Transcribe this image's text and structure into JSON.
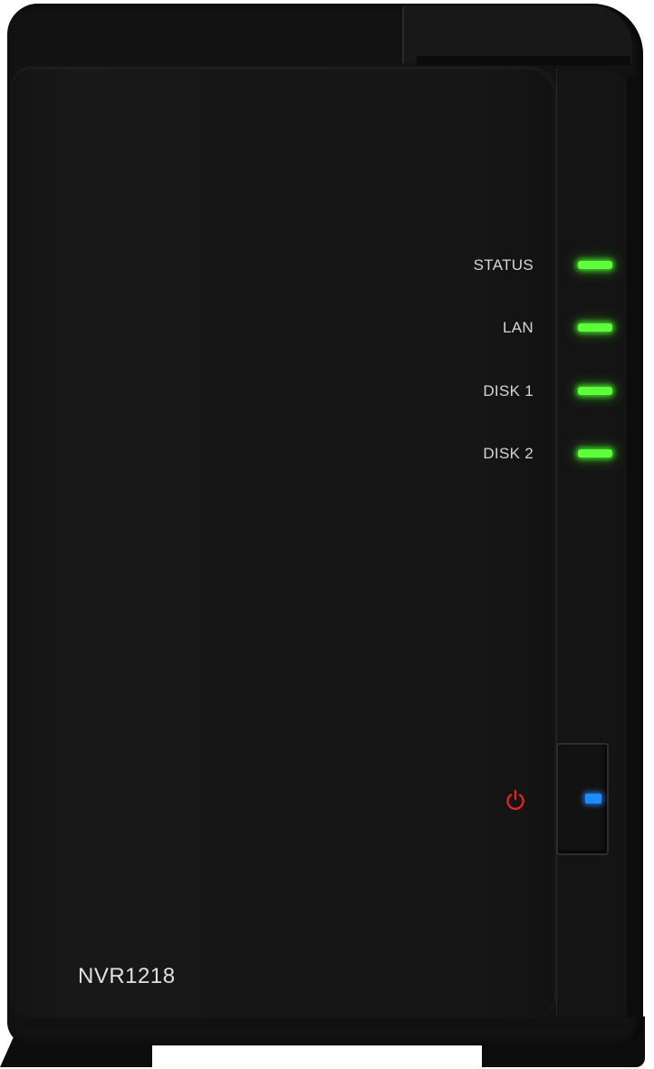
{
  "device": {
    "model": "NVR1218",
    "indicators": [
      {
        "label": "STATUS",
        "state_color": "#5cff3a"
      },
      {
        "label": "LAN",
        "state_color": "#5cff3a"
      },
      {
        "label": "DISK 1",
        "state_color": "#5cff3a"
      },
      {
        "label": "DISK 2",
        "state_color": "#5cff3a"
      }
    ],
    "power": {
      "icon": "power-icon",
      "icon_color": "#e02424",
      "led_color": "#1e8cff"
    }
  }
}
